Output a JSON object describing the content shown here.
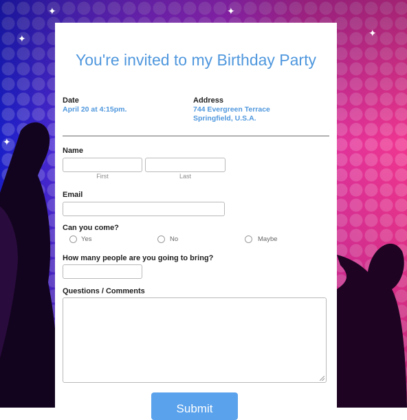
{
  "invitation": {
    "title": "You're invited to my Birthday Party",
    "date_label": "Date",
    "date_value": "April 20 at 4:15pm.",
    "address_label": "Address",
    "address_line1": "744 Evergreen Terrace",
    "address_line2": "Springfield, U.S.A."
  },
  "form": {
    "name_label": "Name",
    "first_sublabel": "First",
    "last_sublabel": "Last",
    "email_label": "Email",
    "attend_label": "Can you come?",
    "attend_options": [
      "Yes",
      "No",
      "Maybe"
    ],
    "guests_label": "How many people are you going to bring?",
    "comments_label": "Questions / Comments",
    "submit_label": "Submit"
  },
  "colors": {
    "accent": "#4f97dd",
    "button": "#5aa2ec"
  }
}
